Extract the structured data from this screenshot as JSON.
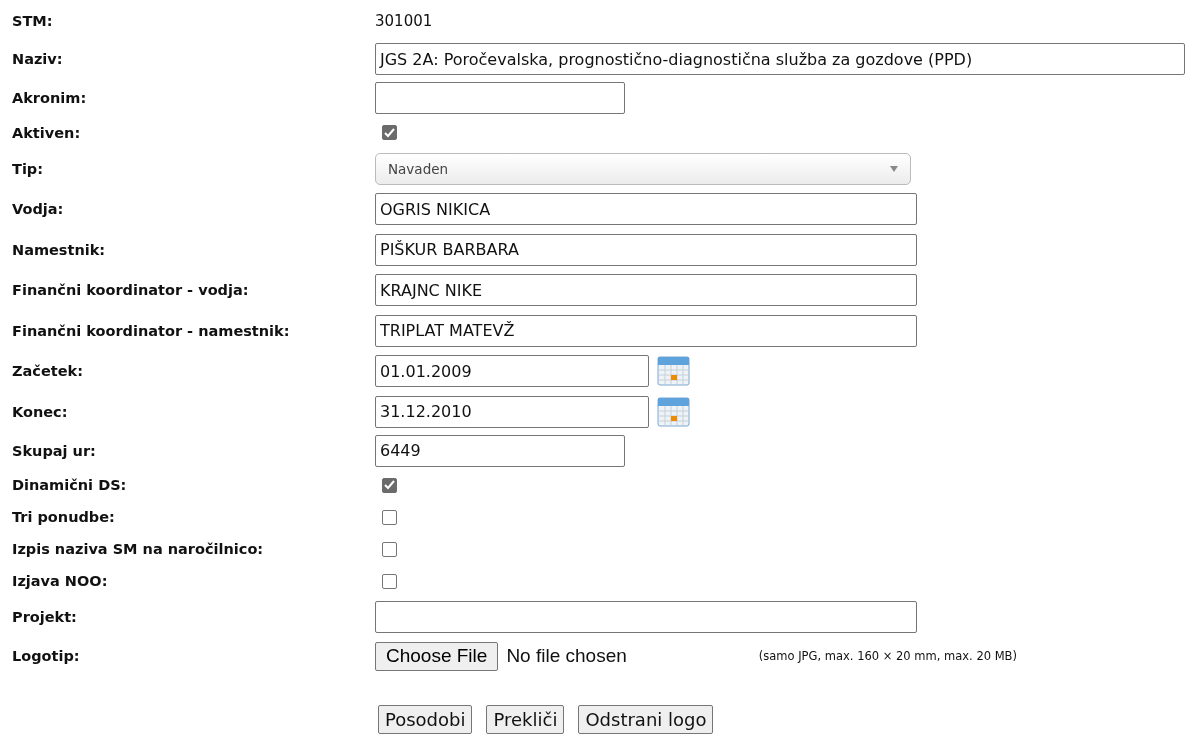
{
  "rows": [
    {
      "kind": "text",
      "label": "STM:",
      "value": "301001"
    },
    {
      "kind": "wide_input",
      "label": "Naziv:",
      "value": "JGS 2A: Poročevalska, prognostično-diagnostična služba za gozdove (PPD)"
    },
    {
      "kind": "short_input",
      "label": "Akronim:"
    },
    {
      "kind": "checkbox",
      "label": "Aktiven:",
      "checked": true
    },
    {
      "kind": "select",
      "label": "Tip:",
      "value": "Navaden"
    },
    {
      "kind": "input",
      "label": "Vodja:",
      "value": "OGRIS NIKICA"
    },
    {
      "kind": "input",
      "label": "Namestnik:",
      "value": "PIŠKUR BARBARA"
    },
    {
      "kind": "input",
      "label": "Finančni koordinator - vodja:",
      "value": "KRAJNC NIKE"
    },
    {
      "kind": "input",
      "label": "Finančni koordinator - namestnik:",
      "value": "TRIPLAT MATEVŽ"
    },
    {
      "kind": "date",
      "label": "Začetek:",
      "value": "01.01.2009"
    },
    {
      "kind": "date",
      "label": "Konec:",
      "value": "31.12.2010"
    },
    {
      "kind": "short_input",
      "label": "Skupaj ur:",
      "value": "6449"
    },
    {
      "kind": "checkbox",
      "label": "Dinamični DS:",
      "checked": true
    },
    {
      "kind": "checkbox",
      "label": "Tri ponudbe:",
      "checked": false
    },
    {
      "kind": "checkbox",
      "label": "Izpis naziva SM na naročilnico:",
      "checked": false
    },
    {
      "kind": "checkbox",
      "label": "Izjava NOO:",
      "checked": false
    },
    {
      "kind": "input",
      "label": "Projekt:"
    },
    {
      "kind": "file",
      "label": "Logotip:",
      "button": "Choose File",
      "status": "No file chosen",
      "hint": "(samo JPG, max. 160 × 20 mm, max. 20 MB)"
    }
  ],
  "buttons": [
    "Posodobi",
    "Prekliči",
    "Odstrani logo"
  ]
}
